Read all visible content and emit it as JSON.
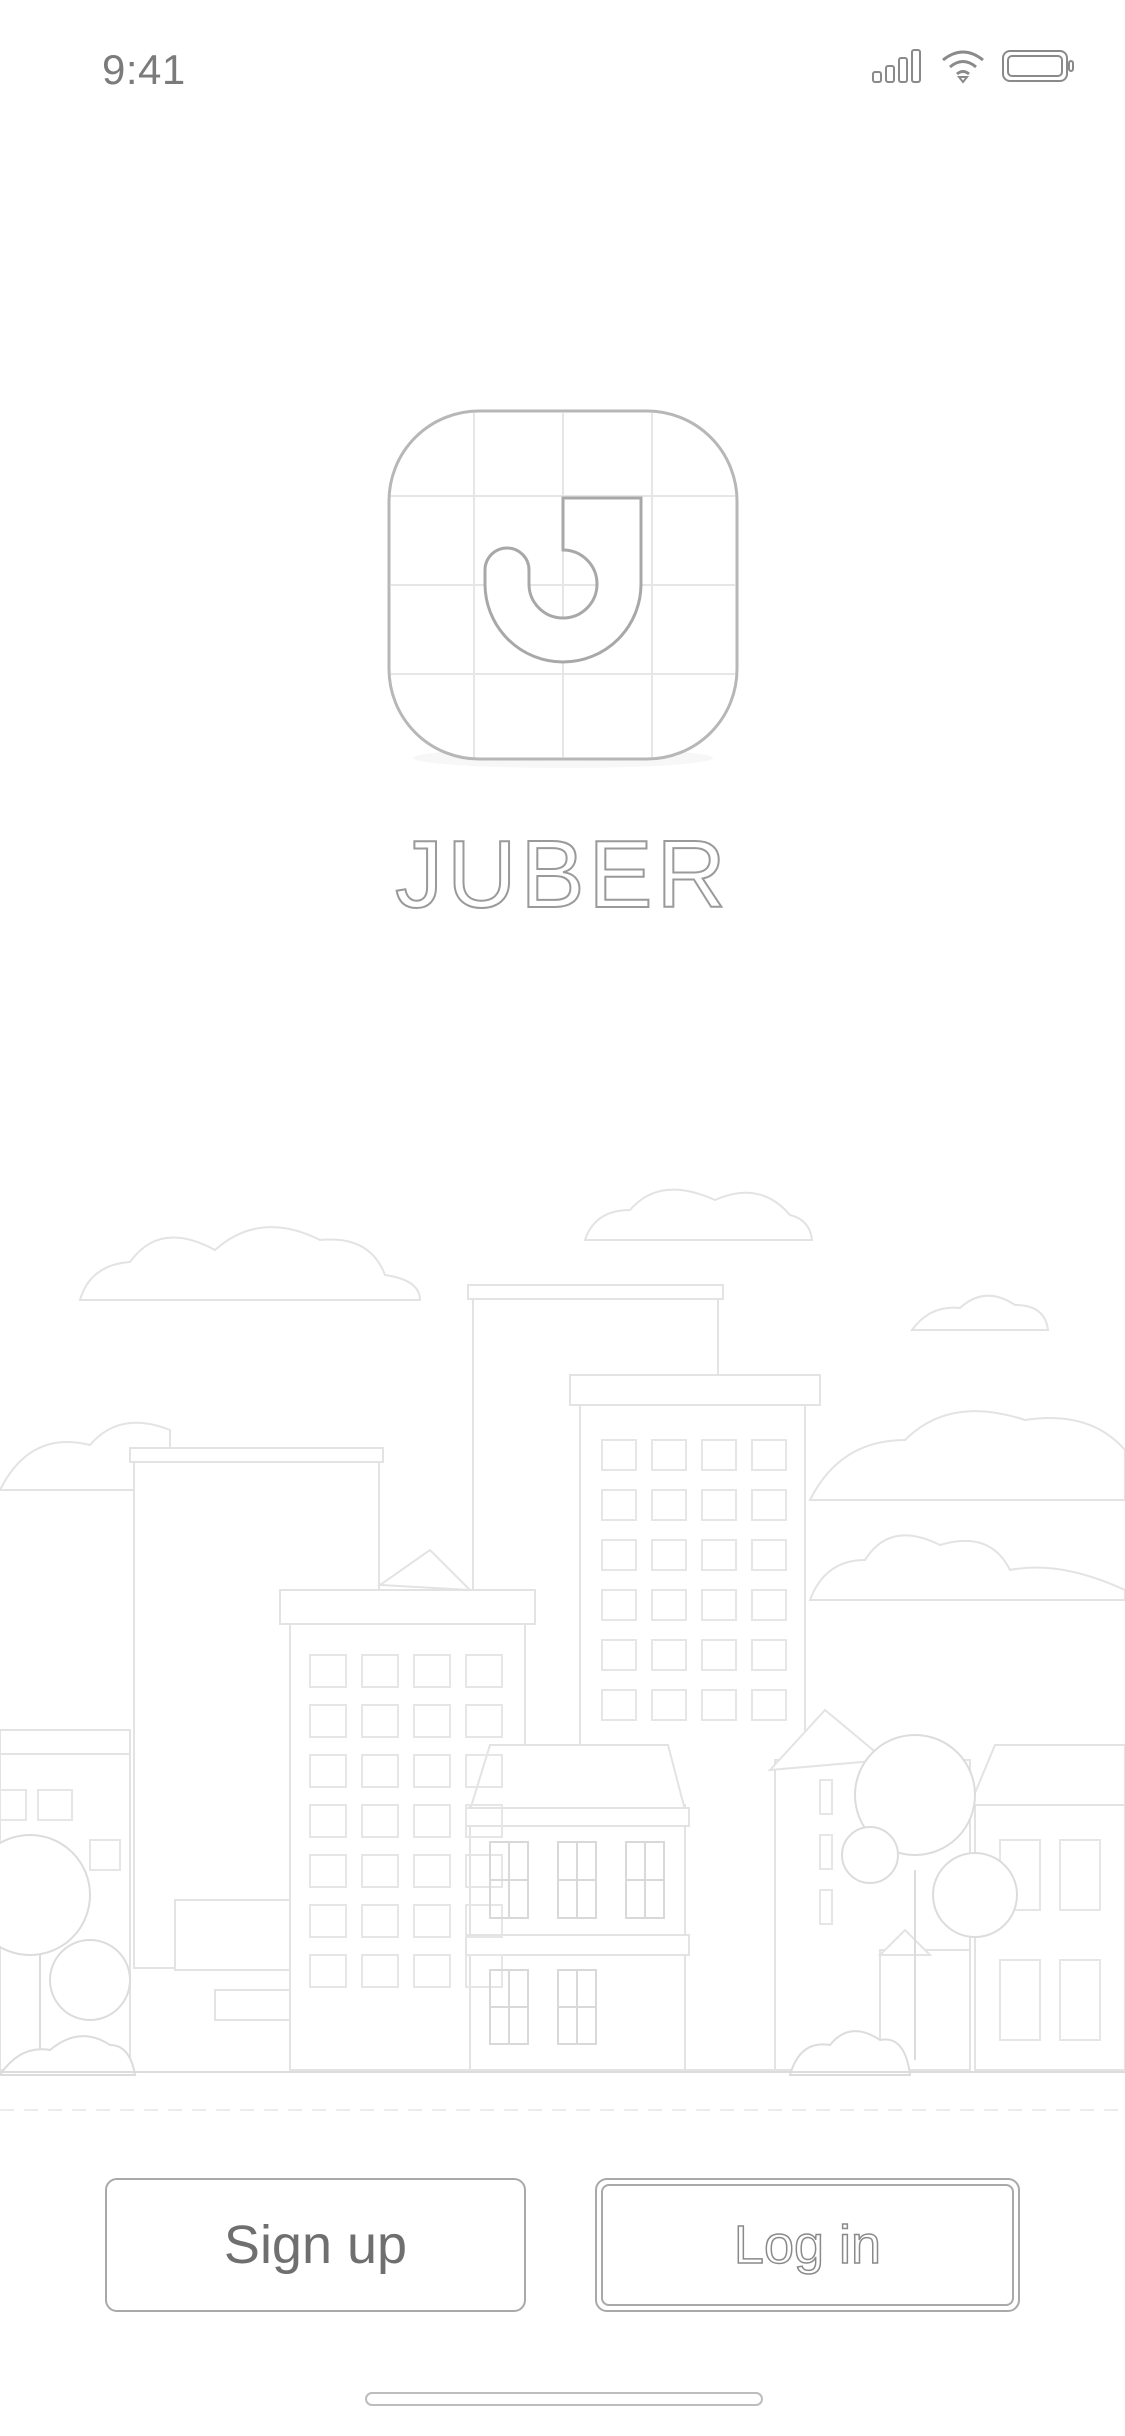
{
  "status_bar": {
    "time": "9:41",
    "icons": [
      "cellular-signal-icon",
      "wifi-icon",
      "battery-icon"
    ]
  },
  "brand": {
    "logo_icon": "app-logo-icon",
    "name": "JUBER"
  },
  "illustration": {
    "icon": "city-skyline-illustration"
  },
  "actions": {
    "signup_label": "Sign up",
    "login_label": "Log in"
  },
  "colors": {
    "background": "#ffffff",
    "line": "#b5b5b5",
    "text": "#7a7a7a"
  }
}
